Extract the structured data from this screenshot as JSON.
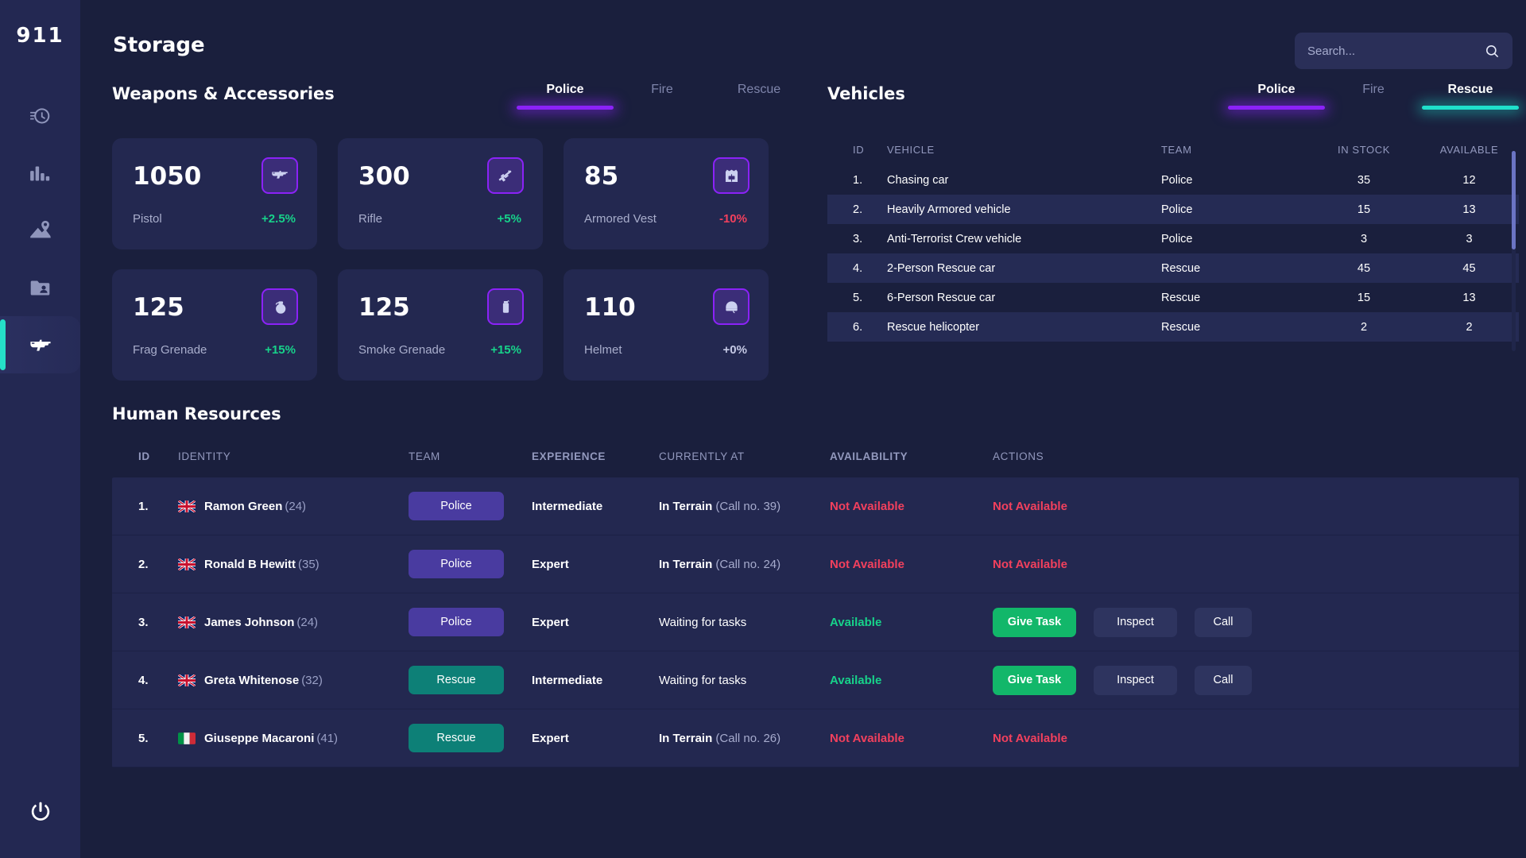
{
  "sidebar": {
    "logo": "911",
    "items": [
      {
        "name": "history-icon",
        "label": "History"
      },
      {
        "name": "analytics-icon",
        "label": "Analytics"
      },
      {
        "name": "map-icon",
        "label": "Map"
      },
      {
        "name": "contacts-icon",
        "label": "Contacts"
      },
      {
        "name": "storage-weapon-icon",
        "label": "Storage",
        "active": true
      }
    ],
    "power_label": "Power"
  },
  "header": {
    "title": "Storage",
    "search_placeholder": "Search...",
    "search_value": "",
    "search_icon": "search-icon"
  },
  "weapons": {
    "title": "Weapons & Accessories",
    "tabs": [
      {
        "label": "Police",
        "active": true,
        "accent": "#8b22f7"
      },
      {
        "label": "Fire",
        "active": false
      },
      {
        "label": "Rescue",
        "active": false
      }
    ],
    "cards": [
      {
        "value": "1050",
        "label": "Pistol",
        "delta": "+2.5%",
        "trend": "up",
        "icon": "pistol-icon"
      },
      {
        "value": "300",
        "label": "Rifle",
        "delta": "+5%",
        "trend": "up",
        "icon": "rifle-icon"
      },
      {
        "value": "85",
        "label": "Armored Vest",
        "delta": "-10%",
        "trend": "down",
        "icon": "armored-vest-icon"
      },
      {
        "value": "125",
        "label": "Frag Grenade",
        "delta": "+15%",
        "trend": "up",
        "icon": "frag-grenade-icon"
      },
      {
        "value": "125",
        "label": "Smoke Grenade",
        "delta": "+15%",
        "trend": "up",
        "icon": "smoke-grenade-icon"
      },
      {
        "value": "110",
        "label": "Helmet",
        "delta": "+0%",
        "trend": "flat",
        "icon": "helmet-icon"
      }
    ]
  },
  "vehicles": {
    "title": "Vehicles",
    "tabs": [
      {
        "label": "Police",
        "active": true,
        "accent": "#8b22f7"
      },
      {
        "label": "Fire",
        "active": false
      },
      {
        "label": "Rescue",
        "active": true,
        "accent": "#1fe0cb"
      }
    ],
    "columns": [
      "ID",
      "VEHICLE",
      "TEAM",
      "IN STOCK",
      "AVAILABLE"
    ],
    "rows": [
      {
        "id": "1.",
        "vehicle": "Chasing car",
        "team": "Police",
        "in_stock": "35",
        "available": "12"
      },
      {
        "id": "2.",
        "vehicle": "Heavily Armored vehicle",
        "team": "Police",
        "in_stock": "15",
        "available": "13"
      },
      {
        "id": "3.",
        "vehicle": "Anti-Terrorist Crew vehicle",
        "team": "Police",
        "in_stock": "3",
        "available": "3"
      },
      {
        "id": "4.",
        "vehicle": "2-Person Rescue car",
        "team": "Rescue",
        "in_stock": "45",
        "available": "45"
      },
      {
        "id": "5.",
        "vehicle": "6-Person Rescue car",
        "team": "Rescue",
        "in_stock": "15",
        "available": "13"
      },
      {
        "id": "6.",
        "vehicle": "Rescue helicopter",
        "team": "Rescue",
        "in_stock": "2",
        "available": "2"
      }
    ]
  },
  "human_resources": {
    "title": "Human Resources",
    "columns": [
      "ID",
      "IDENTITY",
      "TEAM",
      "EXPERIENCE",
      "CURRENTLY AT",
      "AVAILABILITY",
      "ACTIONS"
    ],
    "rows": [
      {
        "id": "1.",
        "flag": "uk",
        "name": "Ramon Green",
        "age": "(24)",
        "team": "Police",
        "experience": "Intermediate",
        "at_main": "In Terrain",
        "at_sub": "(Call no. 39)",
        "availability": "Not Available",
        "available": false,
        "actions_none": "Not Available"
      },
      {
        "id": "2.",
        "flag": "uk",
        "name": "Ronald B Hewitt",
        "age": "(35)",
        "team": "Police",
        "experience": "Expert",
        "at_main": "In Terrain",
        "at_sub": "(Call no. 24)",
        "availability": "Not Available",
        "available": false,
        "actions_none": "Not Available"
      },
      {
        "id": "3.",
        "flag": "uk",
        "name": "James Johnson",
        "age": "(24)",
        "team": "Police",
        "experience": "Expert",
        "at_main": "Waiting for tasks",
        "at_sub": "",
        "availability": "Available",
        "available": true,
        "btn_task": "Give Task",
        "btn_inspect": "Inspect",
        "btn_call": "Call"
      },
      {
        "id": "4.",
        "flag": "uk",
        "name": "Greta Whitenose",
        "age": "(32)",
        "team": "Rescue",
        "experience": "Intermediate",
        "at_main": "Waiting for tasks",
        "at_sub": "",
        "availability": "Available",
        "available": true,
        "btn_task": "Give Task",
        "btn_inspect": "Inspect",
        "btn_call": "Call"
      },
      {
        "id": "5.",
        "flag": "it",
        "name": "Giuseppe Macaroni",
        "age": "(41)",
        "team": "Rescue",
        "experience": "Expert",
        "at_main": "In Terrain",
        "at_sub": "(Call no. 26)",
        "availability": "Not Available",
        "available": false,
        "actions_none": "Not Available"
      }
    ]
  },
  "colors": {
    "background": "#1a1f3d",
    "sidebar": "#232852",
    "card": "#232850",
    "accent_purple": "#8b22f7",
    "accent_teal": "#1fe0cb",
    "green": "#17d28a",
    "red": "#f2405d",
    "badge_police": "#493ba0",
    "badge_rescue": "#0d8077",
    "btn_green": "#12b76a"
  }
}
